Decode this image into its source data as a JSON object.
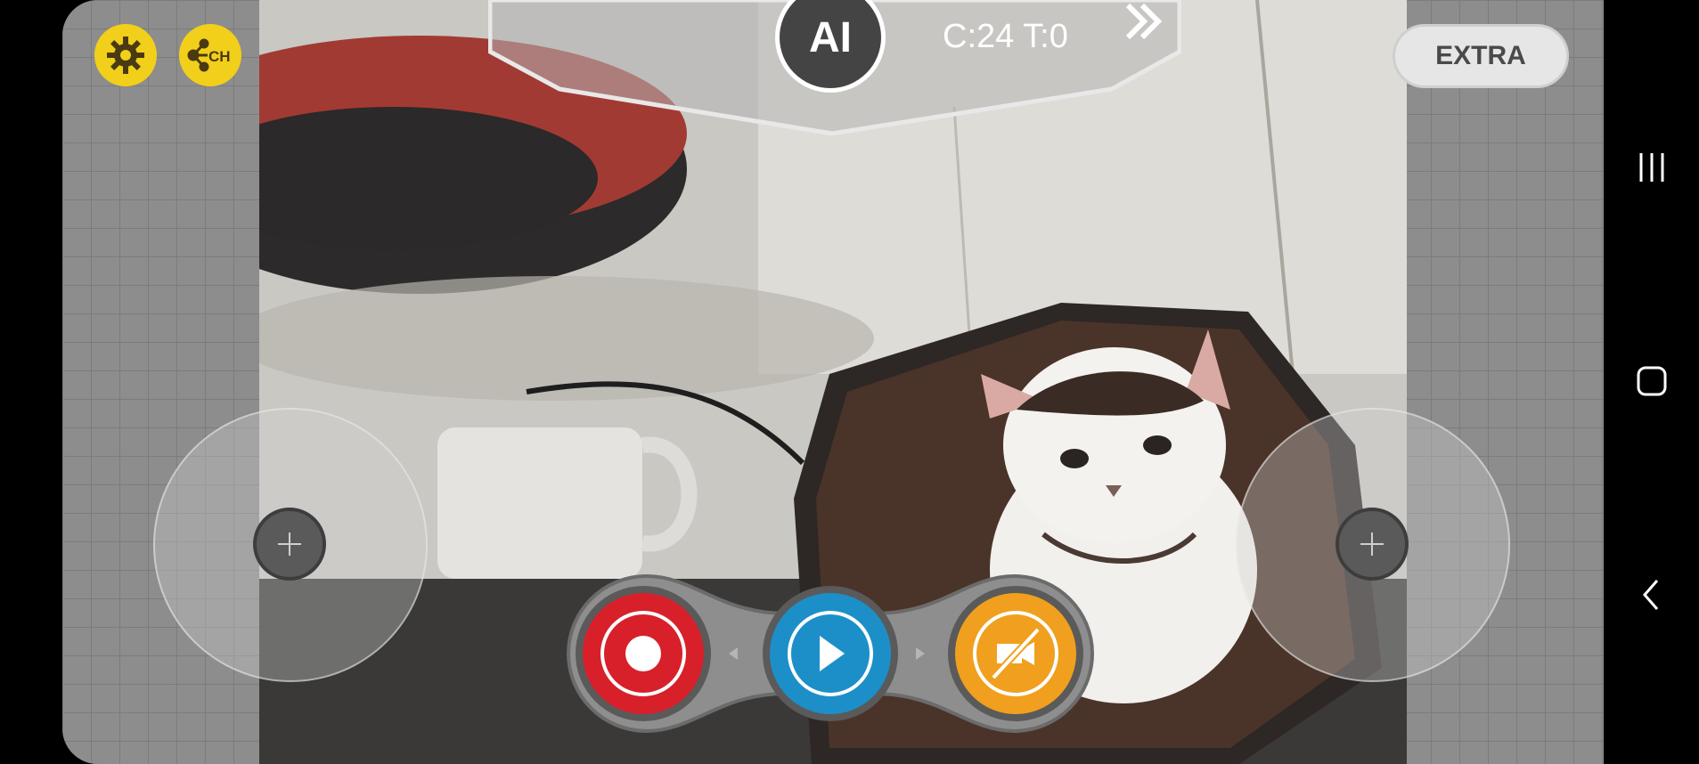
{
  "status": {
    "ai_label": "AI",
    "counter": "C:24 T:0"
  },
  "buttons": {
    "extra_label": "EXTRA",
    "settings_icon": "gear-icon",
    "channel_icon": "channel-network-icon",
    "channel_label": "CH"
  },
  "controls": [
    {
      "name": "record",
      "color": "#d8202a",
      "icon": "record-icon"
    },
    {
      "name": "play",
      "color": "#1d8fc8",
      "icon": "play-icon"
    },
    {
      "name": "video-off",
      "color": "#f0a01e",
      "icon": "video-off-icon"
    }
  ],
  "nav": [
    "recent-apps-icon",
    "home-icon",
    "back-icon"
  ]
}
